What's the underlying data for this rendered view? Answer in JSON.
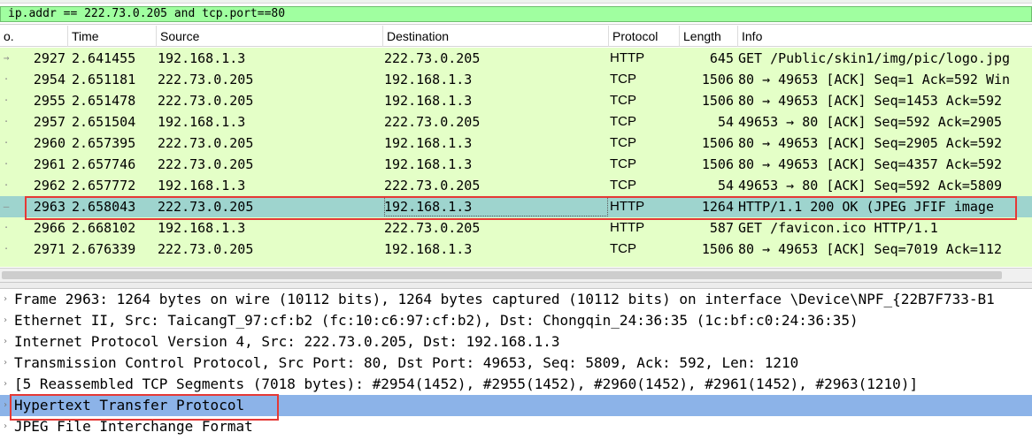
{
  "filter": {
    "value": "ip.addr == 222.73.0.205 and tcp.port==80"
  },
  "packet_list": {
    "columns": [
      "o.",
      "Time",
      "Source",
      "Destination",
      "Protocol",
      "Length",
      "Info"
    ],
    "rows": [
      {
        "no": "2927",
        "time": "2.641455",
        "src": "192.168.1.3",
        "dst": "222.73.0.205",
        "proto": "HTTP",
        "len": "645",
        "info": "GET /Public/skin1/img/pic/logo.jpg",
        "mark": "→"
      },
      {
        "no": "2954",
        "time": "2.651181",
        "src": "222.73.0.205",
        "dst": "192.168.1.3",
        "proto": "TCP",
        "len": "1506",
        "info": "80 → 49653 [ACK] Seq=1 Ack=592 Win",
        "mark": "·"
      },
      {
        "no": "2955",
        "time": "2.651478",
        "src": "222.73.0.205",
        "dst": "192.168.1.3",
        "proto": "TCP",
        "len": "1506",
        "info": "80 → 49653 [ACK] Seq=1453 Ack=592",
        "mark": "·"
      },
      {
        "no": "2957",
        "time": "2.651504",
        "src": "192.168.1.3",
        "dst": "222.73.0.205",
        "proto": "TCP",
        "len": "54",
        "info": "49653 → 80 [ACK] Seq=592 Ack=2905",
        "mark": "·"
      },
      {
        "no": "2960",
        "time": "2.657395",
        "src": "222.73.0.205",
        "dst": "192.168.1.3",
        "proto": "TCP",
        "len": "1506",
        "info": "80 → 49653 [ACK] Seq=2905 Ack=592",
        "mark": "·"
      },
      {
        "no": "2961",
        "time": "2.657746",
        "src": "222.73.0.205",
        "dst": "192.168.1.3",
        "proto": "TCP",
        "len": "1506",
        "info": "80 → 49653 [ACK] Seq=4357 Ack=592",
        "mark": "·"
      },
      {
        "no": "2962",
        "time": "2.657772",
        "src": "192.168.1.3",
        "dst": "222.73.0.205",
        "proto": "TCP",
        "len": "54",
        "info": "49653 → 80 [ACK] Seq=592 Ack=5809",
        "mark": "·"
      },
      {
        "no": "2963",
        "time": "2.658043",
        "src": "222.73.0.205",
        "dst": "192.168.1.3",
        "proto": "HTTP",
        "len": "1264",
        "info": "HTTP/1.1 200 OK  (JPEG JFIF image",
        "mark": "—"
      },
      {
        "no": "2966",
        "time": "2.668102",
        "src": "192.168.1.3",
        "dst": "222.73.0.205",
        "proto": "HTTP",
        "len": "587",
        "info": "GET /favicon.ico HTTP/1.1",
        "mark": "·"
      },
      {
        "no": "2971",
        "time": "2.676339",
        "src": "222.73.0.205",
        "dst": "192.168.1.3",
        "proto": "TCP",
        "len": "1506",
        "info": "80 → 49653 [ACK] Seq=7019 Ack=112",
        "mark": "·"
      }
    ]
  },
  "details": {
    "items": [
      {
        "text": "Frame 2963: 1264 bytes on wire (10112 bits), 1264 bytes captured (10112 bits) on interface \\Device\\NPF_{22B7F733-B1"
      },
      {
        "text": "Ethernet II, Src: TaicangT_97:cf:b2 (fc:10:c6:97:cf:b2), Dst: Chongqin_24:36:35 (1c:bf:c0:24:36:35)"
      },
      {
        "text": "Internet Protocol Version 4, Src: 222.73.0.205, Dst: 192.168.1.3"
      },
      {
        "text": "Transmission Control Protocol, Src Port: 80, Dst Port: 49653, Seq: 5809, Ack: 592, Len: 1210"
      },
      {
        "text": "[5 Reassembled TCP Segments (7018 bytes): #2954(1452), #2955(1452), #2960(1452), #2961(1452), #2963(1210)]"
      },
      {
        "text": "Hypertext Transfer Protocol"
      },
      {
        "text": "JPEG File Interchange Format"
      }
    ]
  },
  "colors": {
    "filter_valid": "#a0ffa0",
    "row_bg": "#e4ffc7",
    "row_selected": "#9ed4ce",
    "detail_selected": "#8cb3e8",
    "highlight_box": "#e53935"
  }
}
